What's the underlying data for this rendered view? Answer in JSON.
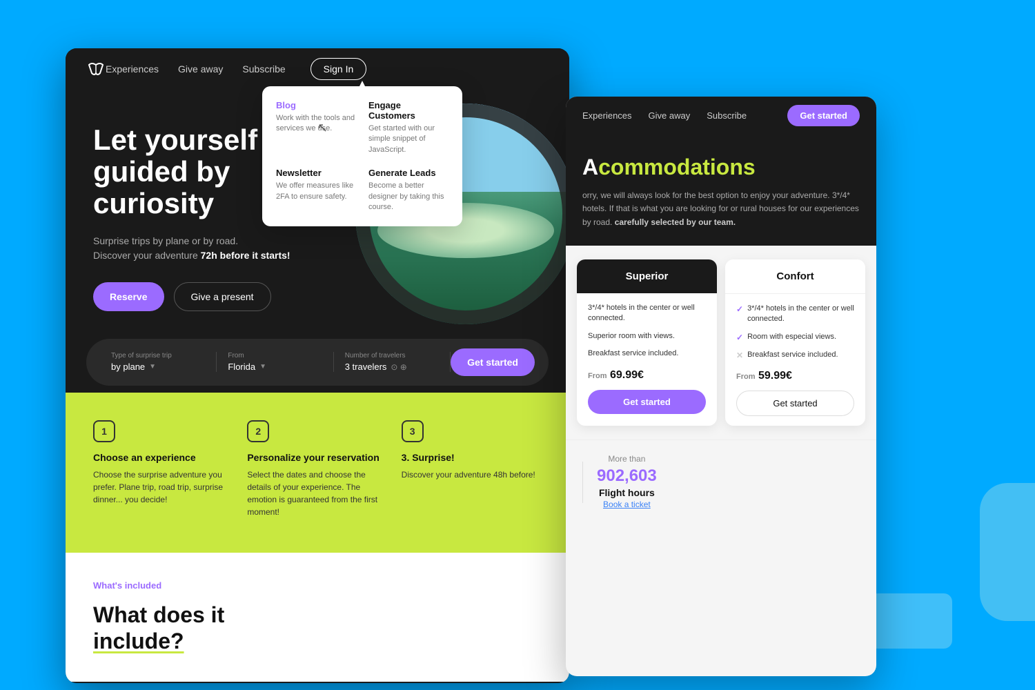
{
  "left_window": {
    "nav": {
      "logo_alt": "W logo",
      "links": [
        "Experiences",
        "Give away",
        "Subscribe"
      ],
      "signin_label": "Sign In"
    },
    "hero": {
      "headline": "Let yourself be guided by curiosity",
      "subtext": "Surprise trips by plane or by road.\nDiscover your adventure ",
      "subtext_bold": "72h before it starts!",
      "btn_reserve": "Reserve",
      "btn_gift": "Give a present"
    },
    "search": {
      "type_label": "Type of surprise trip",
      "type_value": "by plane",
      "from_label": "From",
      "from_value": "Florida",
      "travelers_label": "Number of travelers",
      "travelers_value": "3 travelers",
      "btn_label": "Get started"
    },
    "steps": [
      {
        "number": "1",
        "title": "Choose an experience",
        "desc": "Choose the surprise adventure you prefer. Plane trip, road trip, surprise dinner... you decide!"
      },
      {
        "number": "2",
        "title": "Personalize your reservation",
        "desc": "Select the dates and choose the details of your experience. The emotion is guaranteed from the first moment!"
      },
      {
        "number": "3",
        "title": "3. Surprise!",
        "desc": "Discover your adventure 48h before!"
      }
    ],
    "whats_included": {
      "label": "What's included",
      "title_line1": "What does it",
      "title_line2": "include?"
    }
  },
  "dropdown": {
    "items": [
      {
        "title": "Blog",
        "is_purple": true,
        "desc": "Work with the tools and services we use."
      },
      {
        "title": "Engage Customers",
        "is_purple": false,
        "desc": "Get started with our simple snippet of JavaScript."
      },
      {
        "title": "Newsletter",
        "is_purple": false,
        "desc": "We offer measures like 2FA to ensure safety."
      },
      {
        "title": "Generate Leads",
        "is_purple": false,
        "desc": "Become a better designer by taking this course."
      }
    ]
  },
  "right_window": {
    "nav": {
      "links": [
        "Experiences",
        "Give away",
        "Subscribe"
      ],
      "btn_label": "Get started"
    },
    "hero": {
      "title_highlight": "commodations",
      "title_prefix": "A",
      "desc": "orry, we will always look for the best option to enjoy your adventure. 3*/4* hotels. If that is what you are looking for or rural houses for our experiences by road.",
      "desc_bold": "carefully selected by our team."
    },
    "pricing": {
      "superior": {
        "title": "Superior",
        "features": [
          "3*/4* hotels in the center or well connected.",
          "Superior room with views.",
          "Breakfast service included."
        ],
        "price_label": "From",
        "price": "69.99€",
        "btn_label": "Get started"
      },
      "confort": {
        "title": "Confort",
        "features": [
          {
            "text": "3*/4* hotels in the center or well connected.",
            "icon": "check"
          },
          {
            "text": "Room with especial views.",
            "icon": "check"
          },
          {
            "text": "Breakfast service included.",
            "icon": "cross"
          }
        ],
        "price_label": "From",
        "price": "59.99€",
        "btn_label": "Get started"
      }
    },
    "stats": {
      "label": "More than",
      "number": "902,603",
      "unit": "Flight hours",
      "link": "Book a ticket"
    }
  }
}
